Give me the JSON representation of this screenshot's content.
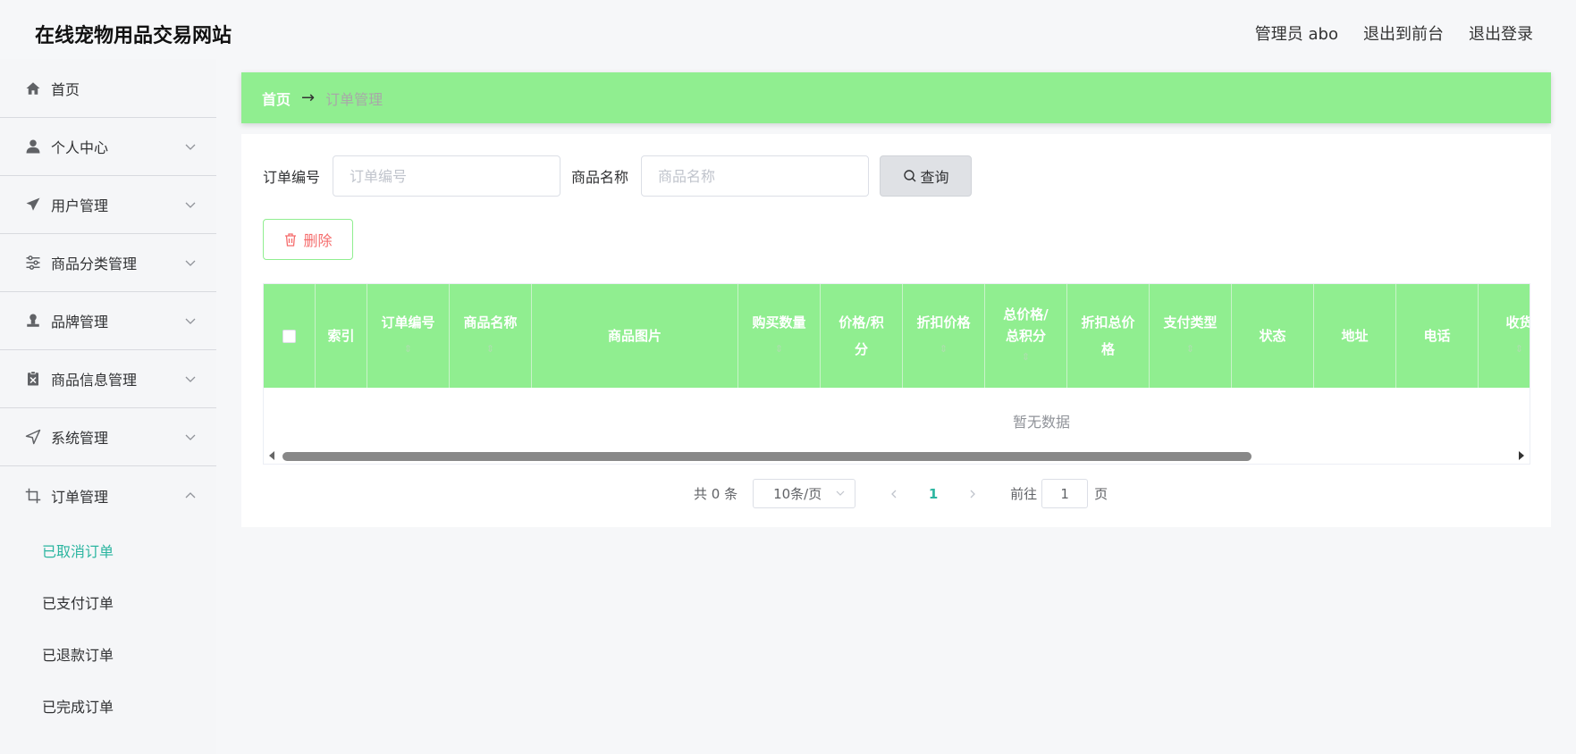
{
  "header": {
    "site_title": "在线宠物用品交易网站",
    "user_label": "管理员 abo",
    "to_frontend": "退出到前台",
    "logout": "退出登录"
  },
  "sidebar": {
    "items": [
      {
        "label": "首页",
        "icon": "home-icon"
      },
      {
        "label": "个人中心",
        "icon": "user-icon"
      },
      {
        "label": "用户管理",
        "icon": "paper-plane-icon"
      },
      {
        "label": "商品分类管理",
        "icon": "sliders-icon"
      },
      {
        "label": "品牌管理",
        "icon": "stamp-icon"
      },
      {
        "label": "商品信息管理",
        "icon": "document-x-icon"
      },
      {
        "label": "系统管理",
        "icon": "navigation-icon"
      },
      {
        "label": "订单管理",
        "icon": "crop-icon"
      }
    ],
    "sub_items": [
      {
        "label": "已取消订单",
        "active": true
      },
      {
        "label": "已支付订单",
        "active": false
      },
      {
        "label": "已退款订单",
        "active": false
      },
      {
        "label": "已完成订单",
        "active": false
      }
    ]
  },
  "breadcrumb": {
    "home": "首页",
    "arrow": "→",
    "current": "订单管理"
  },
  "search": {
    "order_no_label": "订单编号",
    "order_no_placeholder": "订单编号",
    "product_name_label": "商品名称",
    "product_name_placeholder": "商品名称",
    "query_button": "查询"
  },
  "actions": {
    "delete_button": "删除"
  },
  "table": {
    "columns": [
      {
        "line1": "索引",
        "line2": ""
      },
      {
        "line1": "订单编号",
        "line2": ""
      },
      {
        "line1": "商品名称",
        "line2": ""
      },
      {
        "line1": "商品图片",
        "line2": ""
      },
      {
        "line1": "购买数量",
        "line2": ""
      },
      {
        "line1": "价格/积",
        "line2": "分"
      },
      {
        "line1": "折扣价格",
        "line2": ""
      },
      {
        "line1": "总价格/",
        "line2": "总积分"
      },
      {
        "line1": "折扣总价",
        "line2": "格"
      },
      {
        "line1": "支付类型",
        "line2": ""
      },
      {
        "line1": "状态",
        "line2": ""
      },
      {
        "line1": "地址",
        "line2": ""
      },
      {
        "line1": "电话",
        "line2": ""
      },
      {
        "line1": "收货",
        "line2": ""
      }
    ],
    "empty_text": "暂无数据"
  },
  "pagination": {
    "total": "共 0 条",
    "page_size": "10条/页",
    "current_page": "1",
    "goto_label": "前往",
    "goto_value": "1",
    "page_unit": "页"
  },
  "colors": {
    "accent_green": "#90ee90",
    "active_teal": "#2bb5a0",
    "danger_red": "#f56c6c"
  }
}
